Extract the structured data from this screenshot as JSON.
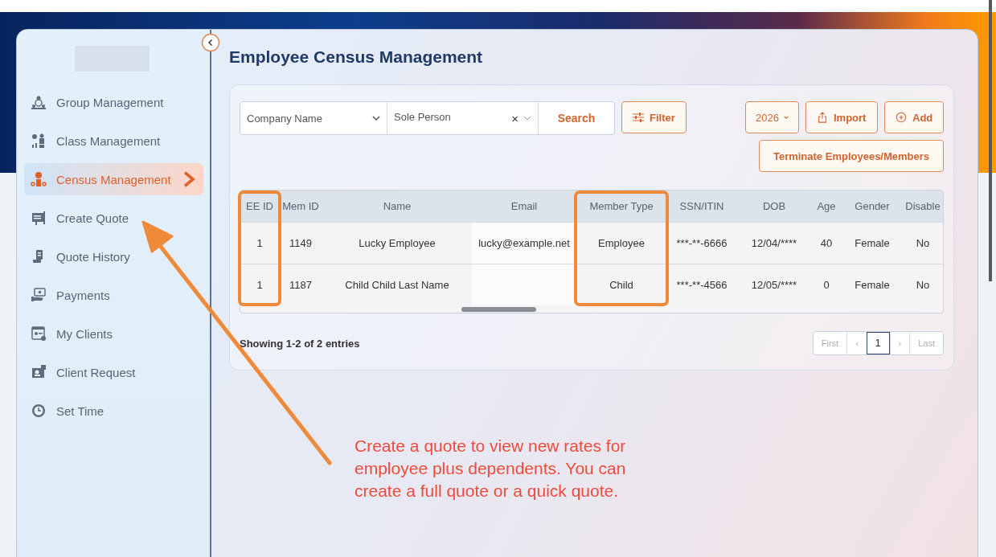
{
  "sidebar": {
    "items": [
      {
        "label": "Group Management",
        "selected": false
      },
      {
        "label": "Class Management",
        "selected": false
      },
      {
        "label": "Census Management",
        "selected": true
      },
      {
        "label": "Create Quote",
        "selected": false
      },
      {
        "label": "Quote History",
        "selected": false
      },
      {
        "label": "Payments",
        "selected": false
      },
      {
        "label": "My Clients",
        "selected": false
      },
      {
        "label": "Client Request",
        "selected": false
      },
      {
        "label": "Set Time",
        "selected": false
      }
    ]
  },
  "page_title": "Employee Census Management",
  "toolbar": {
    "company_select": {
      "placeholder": "Company Name"
    },
    "person_select": {
      "value": "Sole Person",
      "clear": "×"
    },
    "search_button": "Search",
    "filter_button": "Filter",
    "year_select": {
      "value": "2026"
    },
    "import_button": "Import",
    "add_button": "Add",
    "terminate_button": "Terminate Employees/Members"
  },
  "table": {
    "columns": [
      {
        "label": "EE ID",
        "highlighted": true
      },
      {
        "label": "Mem ID",
        "highlighted": false
      },
      {
        "label": "Name",
        "highlighted": false
      },
      {
        "label": "Email",
        "highlighted": false
      },
      {
        "label": "Member Type",
        "highlighted": true
      },
      {
        "label": "SSN/ITIN",
        "highlighted": false
      },
      {
        "label": "DOB",
        "highlighted": false
      },
      {
        "label": "Age",
        "highlighted": false
      },
      {
        "label": "Gender",
        "highlighted": false
      },
      {
        "label": "Disable",
        "highlighted": false
      }
    ],
    "rows": [
      [
        "1",
        "1149",
        "Lucky Employee",
        "lucky@example.net",
        "Employee",
        "***-**-6666",
        "12/04/****",
        "40",
        "Female",
        "No"
      ],
      [
        "1",
        "1187",
        "Child Child Last Name",
        "",
        "Child",
        "***-**-4566",
        "12/05/****",
        "0",
        "Female",
        "No"
      ]
    ]
  },
  "footer": {
    "summary": "Showing 1-2 of 2 entries",
    "pagination": [
      {
        "label": "First",
        "selected": false
      },
      {
        "label": "‹",
        "selected": false
      },
      {
        "label": "1",
        "selected": true
      },
      {
        "label": "›",
        "selected": false
      },
      {
        "label": "Last",
        "selected": false
      }
    ]
  },
  "annotation": {
    "text": "Create a quote to view new rates for\nemployee plus dependents. You can\ncreate a full quote or a quick quote."
  }
}
